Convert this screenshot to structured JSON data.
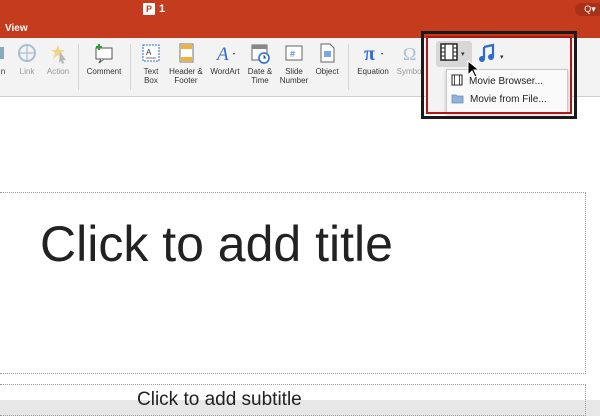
{
  "titlebar": {
    "doc_icon": "P",
    "doc_title": "1",
    "search_icon": "search-icon",
    "search_label": "Q▾"
  },
  "tabs": [
    {
      "label": "View"
    }
  ],
  "ribbon": {
    "items": [
      {
        "label": "n",
        "icon": "partial-icon",
        "enabled": true
      },
      {
        "label": "Link",
        "icon": "link-icon",
        "enabled": false
      },
      {
        "label": "Action",
        "icon": "action-icon",
        "enabled": false
      },
      {
        "label": "Comment",
        "icon": "comment-icon",
        "enabled": true
      },
      {
        "label": "Text\nBox",
        "icon": "text-box-icon",
        "enabled": true
      },
      {
        "label": "Header &\nFooter",
        "icon": "header-footer-icon",
        "enabled": true
      },
      {
        "label": "WordArt",
        "icon": "wordart-icon",
        "enabled": true
      },
      {
        "label": "Date &\nTime",
        "icon": "date-time-icon",
        "enabled": true
      },
      {
        "label": "Slide\nNumber",
        "icon": "slide-number-icon",
        "enabled": true
      },
      {
        "label": "Object",
        "icon": "object-icon",
        "enabled": true
      },
      {
        "label": "Equation",
        "icon": "equation-icon",
        "enabled": true
      },
      {
        "label": "Symbol",
        "icon": "symbol-icon",
        "enabled": false
      }
    ],
    "movie_icon": "movie-film-icon",
    "audio_icon": "audio-note-icon"
  },
  "media_menu": {
    "items": [
      {
        "label": "Movie Browser...",
        "icon": "film-icon"
      },
      {
        "label": "Movie from File...",
        "icon": "folder-icon"
      }
    ]
  },
  "slide": {
    "title_placeholder": "Click to add title",
    "subtitle_placeholder": "Click to add subtitle"
  },
  "colors": {
    "accent": "#c43b1e",
    "highlight_border": "#b01717",
    "icon_blue": "#2d6bd1"
  }
}
